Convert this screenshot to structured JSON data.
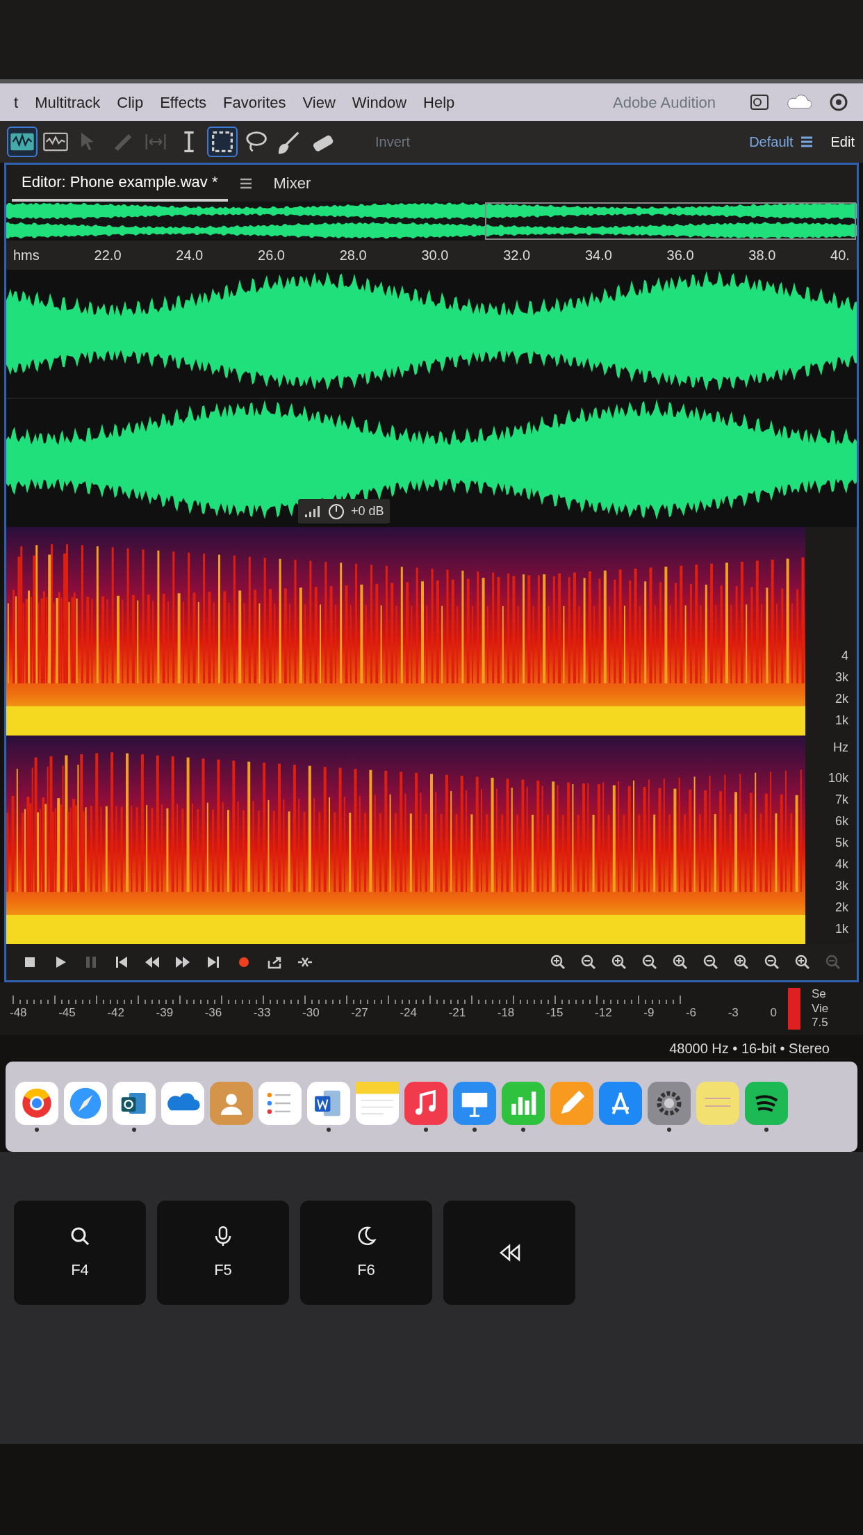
{
  "menu_bar": {
    "items": [
      "t",
      "Multitrack",
      "Clip",
      "Effects",
      "Favorites",
      "View",
      "Window",
      "Help"
    ],
    "title": "Adobe Audition"
  },
  "toolbar": {
    "views": [
      {
        "selected": true
      },
      {
        "selected": false
      }
    ],
    "tools": [
      {
        "disabled": true,
        "selected": false
      },
      {
        "disabled": true,
        "selected": false
      },
      {
        "disabled": true,
        "selected": false
      },
      {
        "disabled": false,
        "selected": false
      },
      {
        "disabled": false,
        "selected": true
      },
      {
        "disabled": false,
        "selected": false
      },
      {
        "disabled": false,
        "selected": false
      },
      {
        "disabled": false,
        "selected": false
      }
    ],
    "invert": "Invert",
    "workspace": "Default",
    "edit": "Edit"
  },
  "tabs": [
    {
      "label": "Editor: Phone example.wav *",
      "selected": true
    },
    {
      "label": "Mixer",
      "selected": false
    }
  ],
  "ruler": {
    "unit": "hms",
    "ticks": [
      "22.0",
      "24.0",
      "26.0",
      "28.0",
      "30.0",
      "32.0",
      "34.0",
      "36.0",
      "38.0",
      "40."
    ]
  },
  "hud": {
    "gain": "+0 dB"
  },
  "spectral": {
    "unit": "Hz",
    "channels": [
      {
        "labels": [
          "4",
          "3k",
          "2k",
          "1k"
        ]
      },
      {
        "labels": [
          "10k",
          "7k",
          "6k",
          "5k",
          "4k",
          "3k",
          "2k",
          "1k"
        ]
      }
    ]
  },
  "transport": [
    {
      "disabled": false
    },
    {
      "disabled": false
    },
    {
      "disabled": true
    },
    {
      "disabled": false
    },
    {
      "disabled": false
    },
    {
      "disabled": false
    },
    {
      "disabled": false
    },
    {
      "disabled": false
    },
    {
      "disabled": false
    },
    {
      "disabled": false
    }
  ],
  "zoom": [
    {
      "disabled": false
    },
    {
      "disabled": false
    },
    {
      "disabled": false
    },
    {
      "disabled": false
    },
    {
      "disabled": false
    },
    {
      "disabled": false
    },
    {
      "disabled": false
    },
    {
      "disabled": false
    },
    {
      "disabled": false
    },
    {
      "disabled": true
    }
  ],
  "meter": {
    "ticks": [
      "-48",
      "-45",
      "-42",
      "-39",
      "-36",
      "-33",
      "-30",
      "-27",
      "-24",
      "-21",
      "-18",
      "-15",
      "-12",
      "-9",
      "-6",
      "-3",
      "0"
    ],
    "clip_indicator": true
  },
  "status": "48000 Hz • 16-bit • Stereo",
  "side_panel": [
    "Se",
    "Vie",
    "7.5"
  ],
  "dock": [
    {
      "running": true
    },
    {
      "running": false
    },
    {
      "running": true
    },
    {
      "running": false
    },
    {
      "running": false
    },
    {
      "running": false
    },
    {
      "running": true
    },
    {
      "running": false
    },
    {
      "running": true
    },
    {
      "running": true
    },
    {
      "running": true
    },
    {
      "running": false
    },
    {
      "running": false
    },
    {
      "running": true
    },
    {
      "running": false
    },
    {
      "running": true
    }
  ],
  "keys": [
    "F4",
    "F5",
    "F6"
  ]
}
